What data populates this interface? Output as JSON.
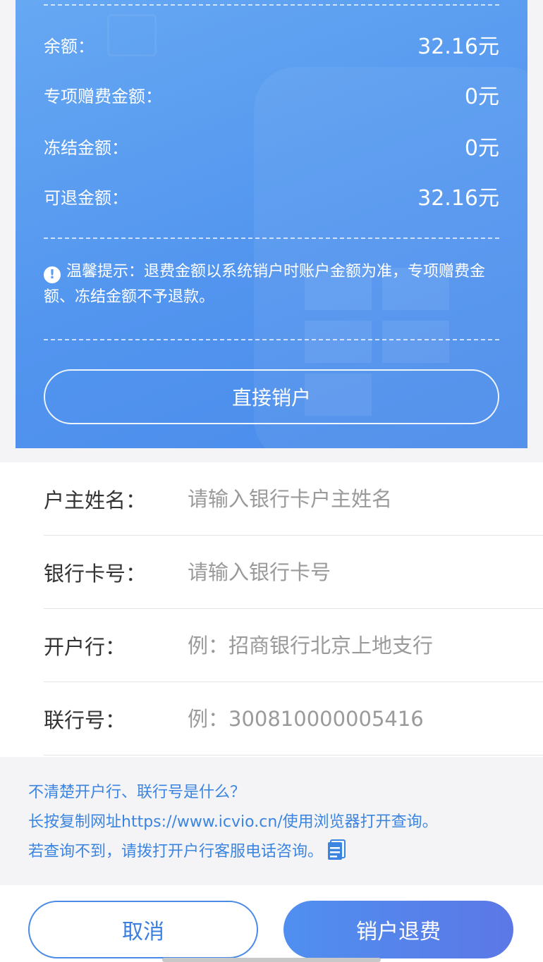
{
  "balance_card": {
    "rows": [
      {
        "label": "余额：",
        "value": "32.16元"
      },
      {
        "label": "专项赠费金额：",
        "value": "0元"
      },
      {
        "label": "冻结金额：",
        "value": "0元"
      },
      {
        "label": "可退金额：",
        "value": "32.16元"
      }
    ],
    "tip_icon": "!",
    "tip_text": "温馨提示：退费金额以系统销户时账户金额为准，专项赠费金额、冻结金额不予退款。",
    "direct_button": "直接销户"
  },
  "form": {
    "fields": [
      {
        "label": "户主姓名：",
        "placeholder": "请输入银行卡户主姓名"
      },
      {
        "label": "银行卡号：",
        "placeholder": "请输入银行卡号"
      },
      {
        "label": "开户行：",
        "placeholder": "例：招商银行北京上地支行"
      },
      {
        "label": "联行号：",
        "placeholder": "例：300810000005416"
      }
    ]
  },
  "help": {
    "line1": "不清楚开户行、联行号是什么？",
    "line2": "长按复制网址https://www.icvio.cn/使用浏览器打开查询。",
    "line3": "若查询不到，请拨打开户行客服电话咨询。",
    "icon": "document-icon"
  },
  "actions": {
    "cancel": "取消",
    "confirm": "销户退费"
  },
  "colors": {
    "card_blue": "#5295ef",
    "link_blue": "#3b85e0",
    "confirm_gradient_start": "#4f8ff0",
    "confirm_gradient_end": "#5c78e6"
  }
}
